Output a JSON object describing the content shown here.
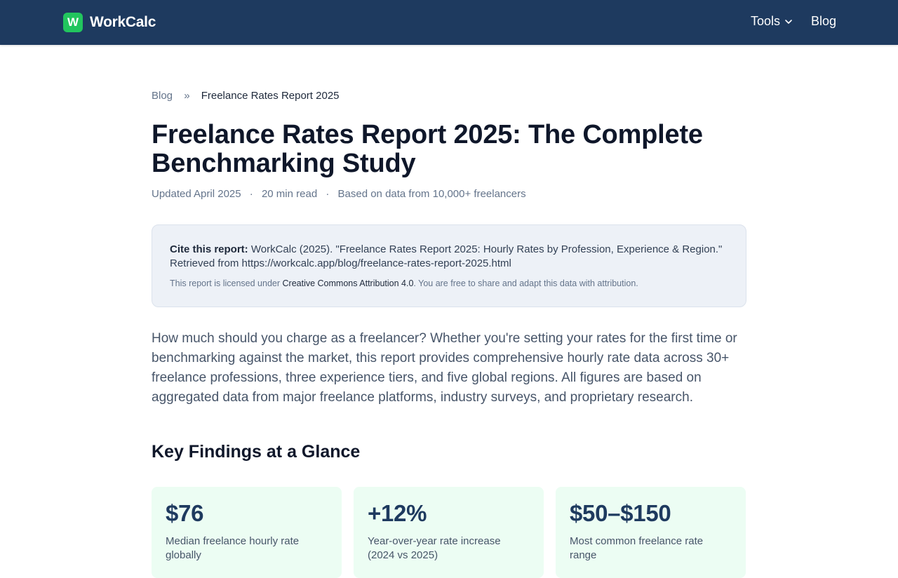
{
  "header": {
    "logo_mark": "W",
    "logo_text": "WorkCalc",
    "nav": {
      "tools": "Tools",
      "blog": "Blog"
    }
  },
  "breadcrumb": {
    "parent": "Blog",
    "separator": "»",
    "current": "Freelance Rates Report 2025"
  },
  "article": {
    "title": "Freelance Rates Report 2025: The Complete Benchmarking Study",
    "meta": {
      "updated": "Updated April 2025",
      "read_time": "20 min read",
      "source": "Based on data from 10,000+ freelancers",
      "separator": "·"
    },
    "cite": {
      "label": "Cite this report:",
      "text": "WorkCalc (2025). \"Freelance Rates Report 2025: Hourly Rates by Profession, Experience & Region.\" Retrieved from https://workcalc.app/blog/freelance-rates-report-2025.html",
      "license_prefix": "This report is licensed under",
      "license_link": "Creative Commons Attribution 4.0",
      "license_suffix": ". You are free to share and adapt this data with attribution."
    },
    "intro": "How much should you charge as a freelancer? Whether you're setting your rates for the first time or benchmarking against the market, this report provides comprehensive hourly rate data across 30+ freelance professions, three experience tiers, and five global regions. All figures are based on aggregated data from major freelance platforms, industry surveys, and proprietary research.",
    "key_findings": {
      "heading": "Key Findings at a Glance",
      "cards": [
        {
          "value": "$76",
          "label": "Median freelance hourly rate globally"
        },
        {
          "value": "+12%",
          "label": "Year-over-year rate increase (2024 vs 2025)"
        },
        {
          "value": "$50–$150",
          "label": "Most common freelance rate range"
        }
      ]
    }
  },
  "colors": {
    "header_bg": "#1e3a5f",
    "logo_accent": "#22c55e",
    "cite_bg": "#edf1f7",
    "card_bg": "#ecfdf3",
    "card_value": "#1e3a5f"
  }
}
